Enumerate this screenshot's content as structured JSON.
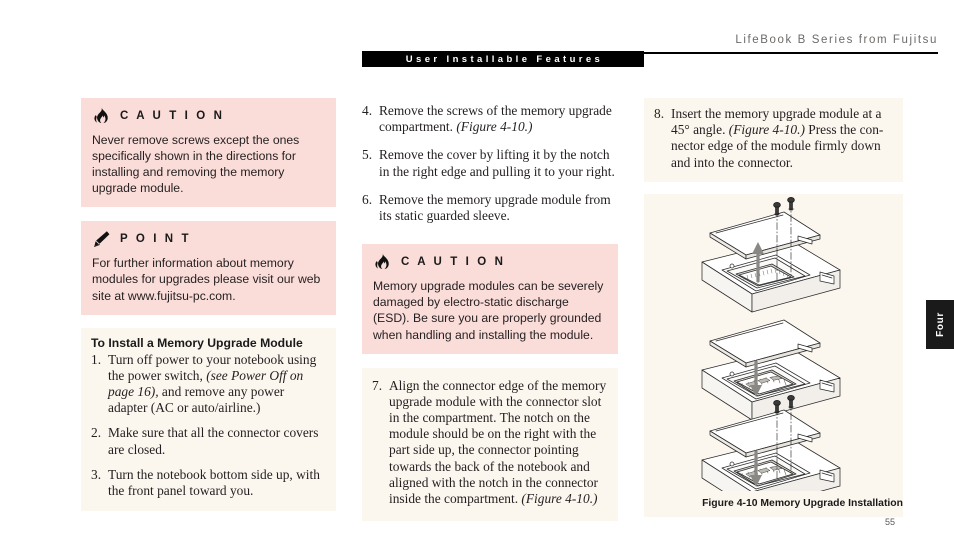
{
  "header": {
    "book_title": "LifeBook B Series from Fujitsu",
    "section_banner": "User Installable Features"
  },
  "left_column": {
    "caution": {
      "icon": "flame-icon",
      "title": "C A U T I O N",
      "body": "Never remove screws except the ones specifically shown in the directions for installing and removing the memory upgrade module."
    },
    "point": {
      "icon": "pencil-icon",
      "title": "P O I N T",
      "body": "For further information about memory modules for upgrades please visit our web site at www.fujitsu-pc.com."
    },
    "procedure_title": "To Install a Memory Upgrade Module",
    "steps": [
      {
        "num": "1.",
        "part1": "Turn off power to your notebook using the power switch, ",
        "italic": "(see Power Off on page 16),",
        "part2": " and remove any power adapter (AC or auto/airline.)"
      },
      {
        "num": "2.",
        "part1": "Make sure that all the connector covers are closed.",
        "italic": "",
        "part2": ""
      },
      {
        "num": "3.",
        "part1": "Turn the notebook bottom side up, with the front panel toward you.",
        "italic": "",
        "part2": ""
      }
    ]
  },
  "middle_column": {
    "steps_top": [
      {
        "num": "4.",
        "part1": "Remove the screws of the memory upgrade compartment. ",
        "italic": "(Figure 4-10.)",
        "part2": ""
      },
      {
        "num": "5.",
        "part1": "Remove the cover by lifting it by the notch in the right edge and pulling it to your right.",
        "italic": "",
        "part2": ""
      },
      {
        "num": "6.",
        "part1": "Remove the memory upgrade module from its static guarded sleeve.",
        "italic": "",
        "part2": ""
      }
    ],
    "caution": {
      "icon": "flame-icon",
      "title": "C A U T I O N",
      "body": "Memory upgrade modules can be severely damaged by electro-static discharge (ESD). Be sure you are properly grounded when handling and installing the module."
    },
    "steps_bottom": [
      {
        "num": "7.",
        "part1": "Align the connector edge of the memory upgrade module with the connector slot in the compartment. The notch on the module should be on the right with the part side up, the connector pointing towards the back of the notebook and aligned with the notch in the connector inside the compartment. ",
        "italic": "(Figure 4-10.)",
        "part2": ""
      }
    ]
  },
  "right_column": {
    "steps": [
      {
        "num": "8.",
        "part1": "Insert the memory upgrade module at a 45° angle. ",
        "italic": "(Figure 4-10.)",
        "part2": " Press the con-nector edge of the module firmly down and into the connector."
      }
    ],
    "figure": {
      "name": "memory-upgrade-installation-diagram",
      "caption": "Figure 4-10 Memory Upgrade Installation"
    }
  },
  "chapter_tab": {
    "label": "Four"
  },
  "page_number": "55",
  "colors": {
    "caution_bg": "#fadcd9",
    "tinted_bg": "#fbf6ee",
    "banner_bg": "#000000",
    "header_text": "#6d6a68"
  }
}
